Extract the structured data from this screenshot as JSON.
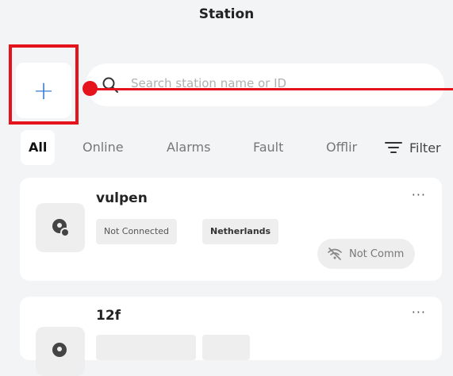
{
  "header": {
    "title": "Station"
  },
  "add_button": {
    "label": "+"
  },
  "search": {
    "placeholder": "Search station name or ID"
  },
  "tabs": [
    {
      "label": "All"
    },
    {
      "label": "Online"
    },
    {
      "label": "Alarms"
    },
    {
      "label": "Fault"
    },
    {
      "label": "Offlir"
    }
  ],
  "filter": {
    "label": "Filter"
  },
  "stations": [
    {
      "name": "vulpen",
      "tags": [
        "Not Connected",
        "Netherlands"
      ],
      "status": "Not Comm",
      "more": "···"
    },
    {
      "name": "12f",
      "more": "···"
    }
  ],
  "colors": {
    "accent": "#3a7bd5",
    "annotation": "#e5141c",
    "background": "#f3f4f6",
    "card": "#ffffff"
  },
  "icons": {
    "search": "search-icon",
    "filter": "filter-icon",
    "station": "station-pin-icon",
    "not_comm": "wifi-off-icon"
  }
}
